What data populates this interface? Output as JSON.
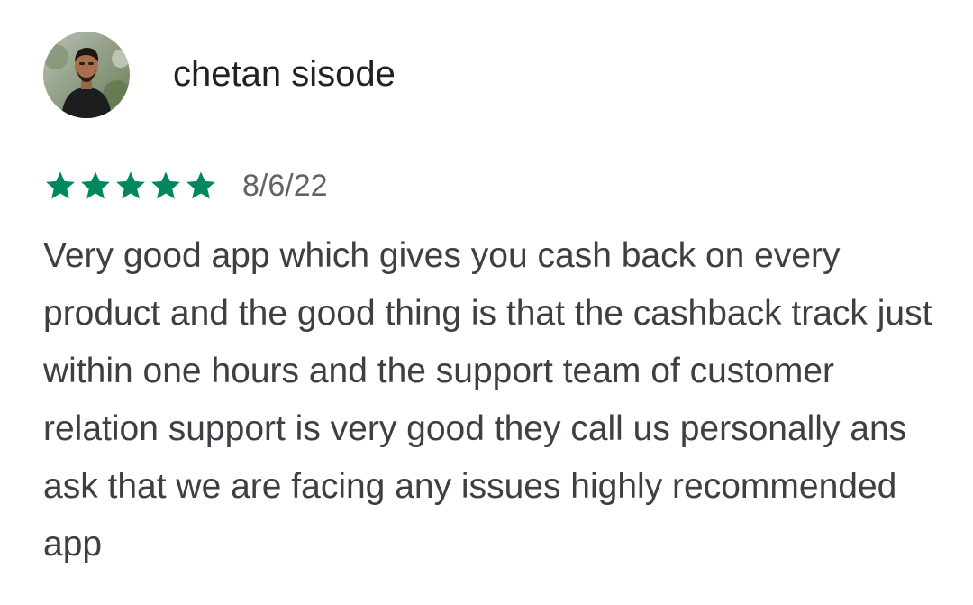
{
  "review": {
    "author": "chetan sisode",
    "rating": 5,
    "rating_max": 5,
    "star_color": "#01875f",
    "date": "8/6/22",
    "text": "Very good app which gives you cash back on every product and the good thing is that the cashback track just within one hours and the support team of customer relation support is very good they call us personally ans ask that we are facing any issues highly recommended app"
  }
}
